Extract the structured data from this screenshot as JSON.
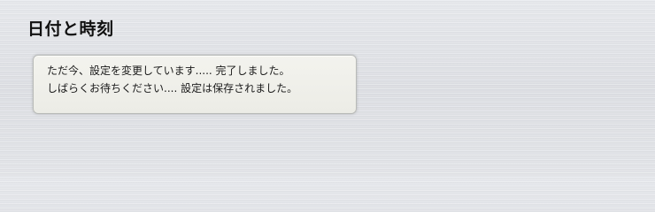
{
  "page": {
    "title": "日付と時刻"
  },
  "status": {
    "line1": "ただ今、設定を変更しています..... 完了しました。",
    "line2": "しばらくお待ちください.... 設定は保存されました。"
  }
}
